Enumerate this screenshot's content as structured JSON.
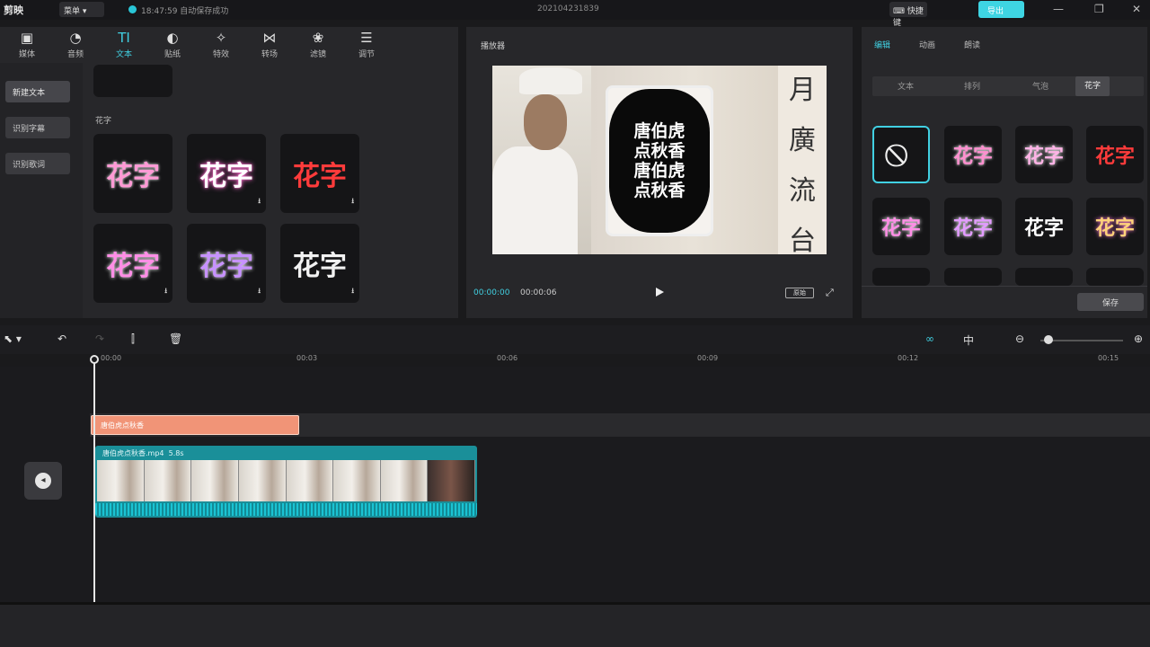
{
  "app": {
    "name": "剪映",
    "menu": "菜单",
    "saved_time": "18:47:59",
    "saved_text": "自动保存成功",
    "project": "202104231839",
    "shortcut": "快捷键",
    "export": "导出"
  },
  "toolbar": {
    "tools": [
      {
        "icon": "media-icon",
        "label": "媒体"
      },
      {
        "icon": "audio-icon",
        "label": "音频"
      },
      {
        "icon": "text-icon",
        "label": "文本"
      },
      {
        "icon": "sticker-icon",
        "label": "贴纸"
      },
      {
        "icon": "effects-icon",
        "label": "特效"
      },
      {
        "icon": "transition-icon",
        "label": "转场"
      },
      {
        "icon": "filter-icon",
        "label": "滤镜"
      },
      {
        "icon": "adjust-icon",
        "label": "调节"
      }
    ]
  },
  "leftnav": {
    "items": [
      "新建文本",
      "识别字幕",
      "识别歌词"
    ]
  },
  "library": {
    "section": "花字",
    "tiles": [
      {
        "text": "花字",
        "color": "#ff9ad5"
      },
      {
        "text": "花字",
        "color": "#ffffff"
      },
      {
        "text": "花字",
        "color": "#ff3b3b"
      },
      {
        "text": "花字",
        "color": "#ff8ee6"
      },
      {
        "text": "花字",
        "color": "#c792ff"
      },
      {
        "text": "花字",
        "color": "#f2f2f2"
      }
    ]
  },
  "player": {
    "title": "播放器",
    "overlay_lines": [
      "唐伯虎",
      "点秋香",
      "唐伯虎",
      "点秋香"
    ],
    "scroll_text": "月廣流台",
    "current_time": "00:00:00",
    "total_time": "00:00:06",
    "ratio": "原始"
  },
  "inspector": {
    "tabs": [
      "编辑",
      "动画",
      "朗读"
    ],
    "subtabs": [
      "文本",
      "排列",
      "气泡",
      "花字"
    ],
    "tiles": [
      {
        "text": "",
        "color": "#ffffff"
      },
      {
        "text": "花字",
        "color": "#ff8fcf"
      },
      {
        "text": "花字",
        "color": "#ffb3e6"
      },
      {
        "text": "花字",
        "color": "#ff3b3b"
      },
      {
        "text": "花字",
        "color": "#ff8ee6"
      },
      {
        "text": "花字",
        "color": "#e29bff"
      },
      {
        "text": "花字",
        "color": "#ffffff"
      },
      {
        "text": "花字",
        "color": "#ffd27a"
      }
    ],
    "apply": "保存"
  },
  "timeline": {
    "ruler": [
      "00:00",
      "00:03",
      "00:06",
      "00:09",
      "00:12",
      "00:15"
    ],
    "text_clip": "唐伯虎点秋香",
    "video_clip": {
      "name": "唐伯虎点秋香.mp4",
      "duration": "5.8s"
    }
  },
  "colors": {
    "accent": "#41d0e2",
    "text_clip": "#f19477",
    "video_clip": "#1a8f99"
  }
}
